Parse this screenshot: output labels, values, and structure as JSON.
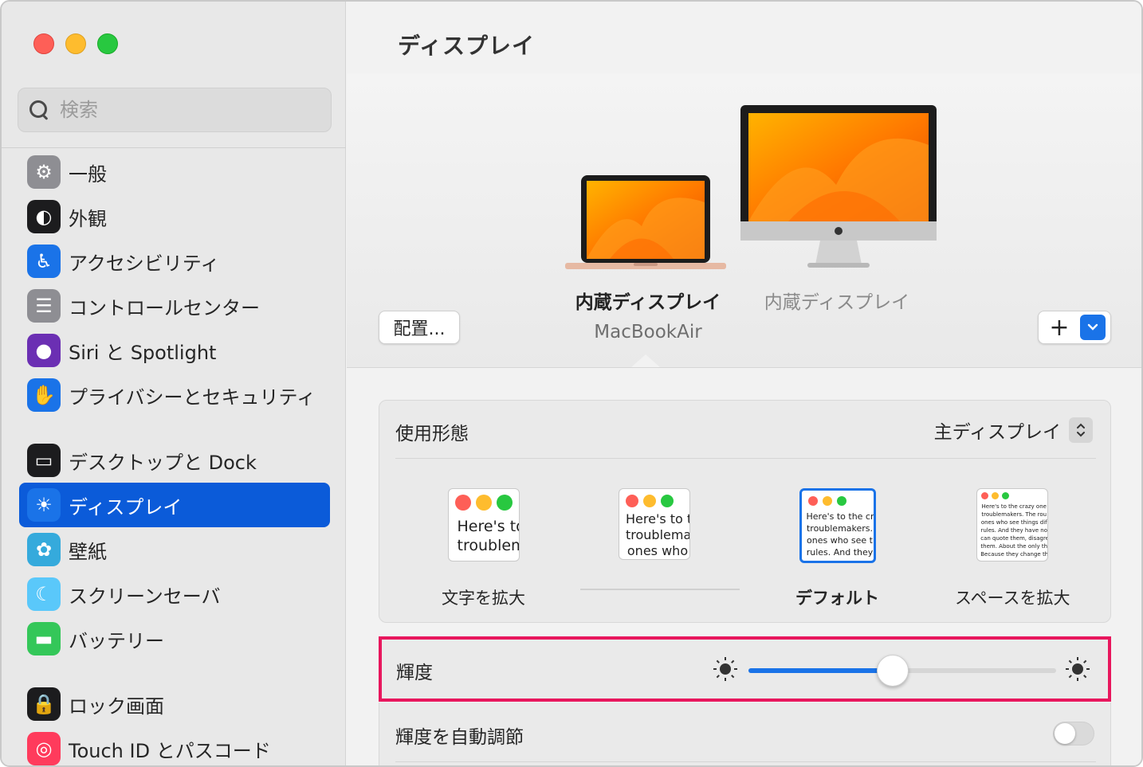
{
  "sidebar": {
    "search_placeholder": "検索",
    "items": [
      {
        "label": "一般",
        "icon": "gear-icon",
        "color": "#8e8e93"
      },
      {
        "label": "外観",
        "icon": "appearance-icon",
        "color": "#1c1c1e"
      },
      {
        "label": "アクセシビリティ",
        "icon": "accessibility-icon",
        "color": "#1a73e8"
      },
      {
        "label": "コントロールセンター",
        "icon": "control-center-icon",
        "color": "#8e8e93"
      },
      {
        "label": "Siri と Spotlight",
        "icon": "siri-icon",
        "color": "#6b2fb3"
      },
      {
        "label": "プライバシーとセキュリティ",
        "icon": "hand-icon",
        "color": "#1a73e8"
      },
      {
        "label": "デスクトップと Dock",
        "icon": "dock-icon",
        "color": "#1c1c1e"
      },
      {
        "label": "ディスプレイ",
        "icon": "sun-icon",
        "color": "#1a73e8"
      },
      {
        "label": "壁紙",
        "icon": "wallpaper-icon",
        "color": "#35aadc"
      },
      {
        "label": "スクリーンセーバ",
        "icon": "screensaver-icon",
        "color": "#5ac8fa"
      },
      {
        "label": "バッテリー",
        "icon": "battery-icon",
        "color": "#34c759"
      },
      {
        "label": "ロック画面",
        "icon": "lock-icon",
        "color": "#1c1c1e"
      },
      {
        "label": "Touch ID とパスコード",
        "icon": "fingerprint-icon",
        "color": "#ff3b5c"
      }
    ],
    "active_index": 7
  },
  "main": {
    "title": "ディスプレイ",
    "arrange_label": "配置...",
    "add_label": "+",
    "displays": [
      {
        "name": "内蔵ディスプレイ",
        "model": "MacBookAir",
        "selected": true
      },
      {
        "name": "内蔵ディスプレイ",
        "selected": false
      }
    ],
    "usage": {
      "label": "使用形態",
      "value": "主ディスプレイ"
    },
    "resolution_options": [
      {
        "label": "文字を拡大",
        "preview": [
          "Here's to",
          "troublem"
        ]
      },
      {
        "label": "",
        "preview": [
          "Here's to t",
          "troublema",
          "ones who"
        ]
      },
      {
        "label": "デフォルト",
        "preview": [
          "Here's to the cr",
          "troublemakers.",
          "ones who see t",
          "rules. And they"
        ],
        "selected": true
      },
      {
        "label": "スペースを拡大",
        "preview": [
          "Here's to the crazy one",
          "troublemakers. The rou",
          "ones who see things dif",
          "rules. And they have no",
          "can quote them, disagre",
          "them. About the only th",
          "Because they change th"
        ]
      }
    ],
    "brightness": {
      "label": "輝度",
      "value": 0.47
    },
    "auto_brightness": {
      "label": "輝度を自動調節",
      "on": false
    }
  },
  "colors": {
    "accent": "#1a73e8",
    "highlight": "#e8175d"
  }
}
